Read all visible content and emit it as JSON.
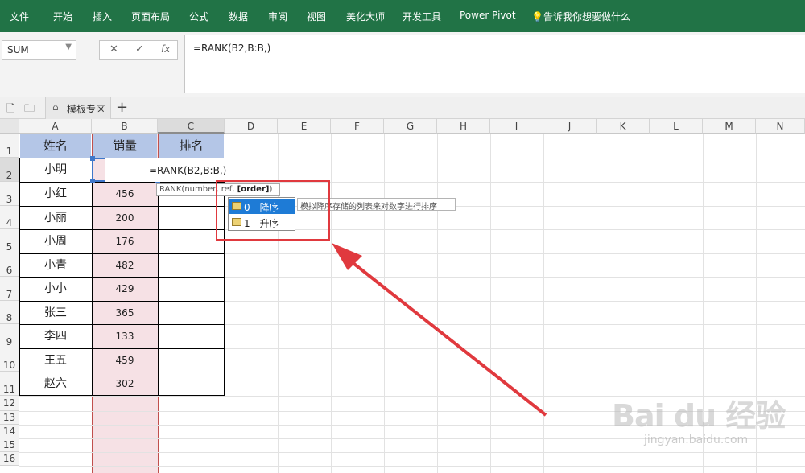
{
  "ribbon": {
    "tabs": [
      "文件",
      "开始",
      "插入",
      "页面布局",
      "公式",
      "数据",
      "审阅",
      "视图",
      "美化大师",
      "开发工具",
      "Power Pivot",
      "告诉我你想要做什么"
    ]
  },
  "formula_bar": {
    "name_box": "SUM",
    "cancel_icon": "✕",
    "enter_icon": "✓",
    "fx_label": "fx",
    "formula": "=RANK(B2,B:B,)"
  },
  "sheet_tabs": {
    "template_tab": "模板专区",
    "add_label": "+"
  },
  "grid": {
    "columns": [
      "A",
      "B",
      "C",
      "D",
      "E",
      "F",
      "G",
      "H",
      "I",
      "J",
      "K",
      "L",
      "M",
      "N"
    ],
    "rows": [
      "1",
      "2",
      "3",
      "4",
      "5",
      "6",
      "7",
      "8",
      "9",
      "10",
      "11",
      "12",
      "13",
      "14",
      "15",
      "16"
    ],
    "headers": [
      "姓名",
      "销量",
      "排名"
    ],
    "names": [
      "小明",
      "小红",
      "小丽",
      "小周",
      "小青",
      "小小",
      "张三",
      "李四",
      "王五",
      "赵六"
    ],
    "sales": [
      "",
      "456",
      "200",
      "176",
      "482",
      "429",
      "365",
      "133",
      "459",
      "302"
    ]
  },
  "editing": {
    "cell_text": "=RANK(B2,B:B,)",
    "hint_prefix": "RANK(number, ref, ",
    "hint_bold": "[order]",
    "hint_suffix": ")"
  },
  "autocomplete": {
    "items": [
      "0 - 降序",
      "1 - 升序"
    ],
    "tooltip": "模拟降序存储的列表来对数字进行排序"
  },
  "watermark": {
    "logo": "Bai du 经验",
    "url": "jingyan.baidu.com"
  },
  "colors": {
    "ribbon": "#217346",
    "header_fill": "#b4c6e7",
    "sales_fill": "#f6e1e5",
    "highlight": "#e0393e",
    "selection": "#3f77c9"
  }
}
